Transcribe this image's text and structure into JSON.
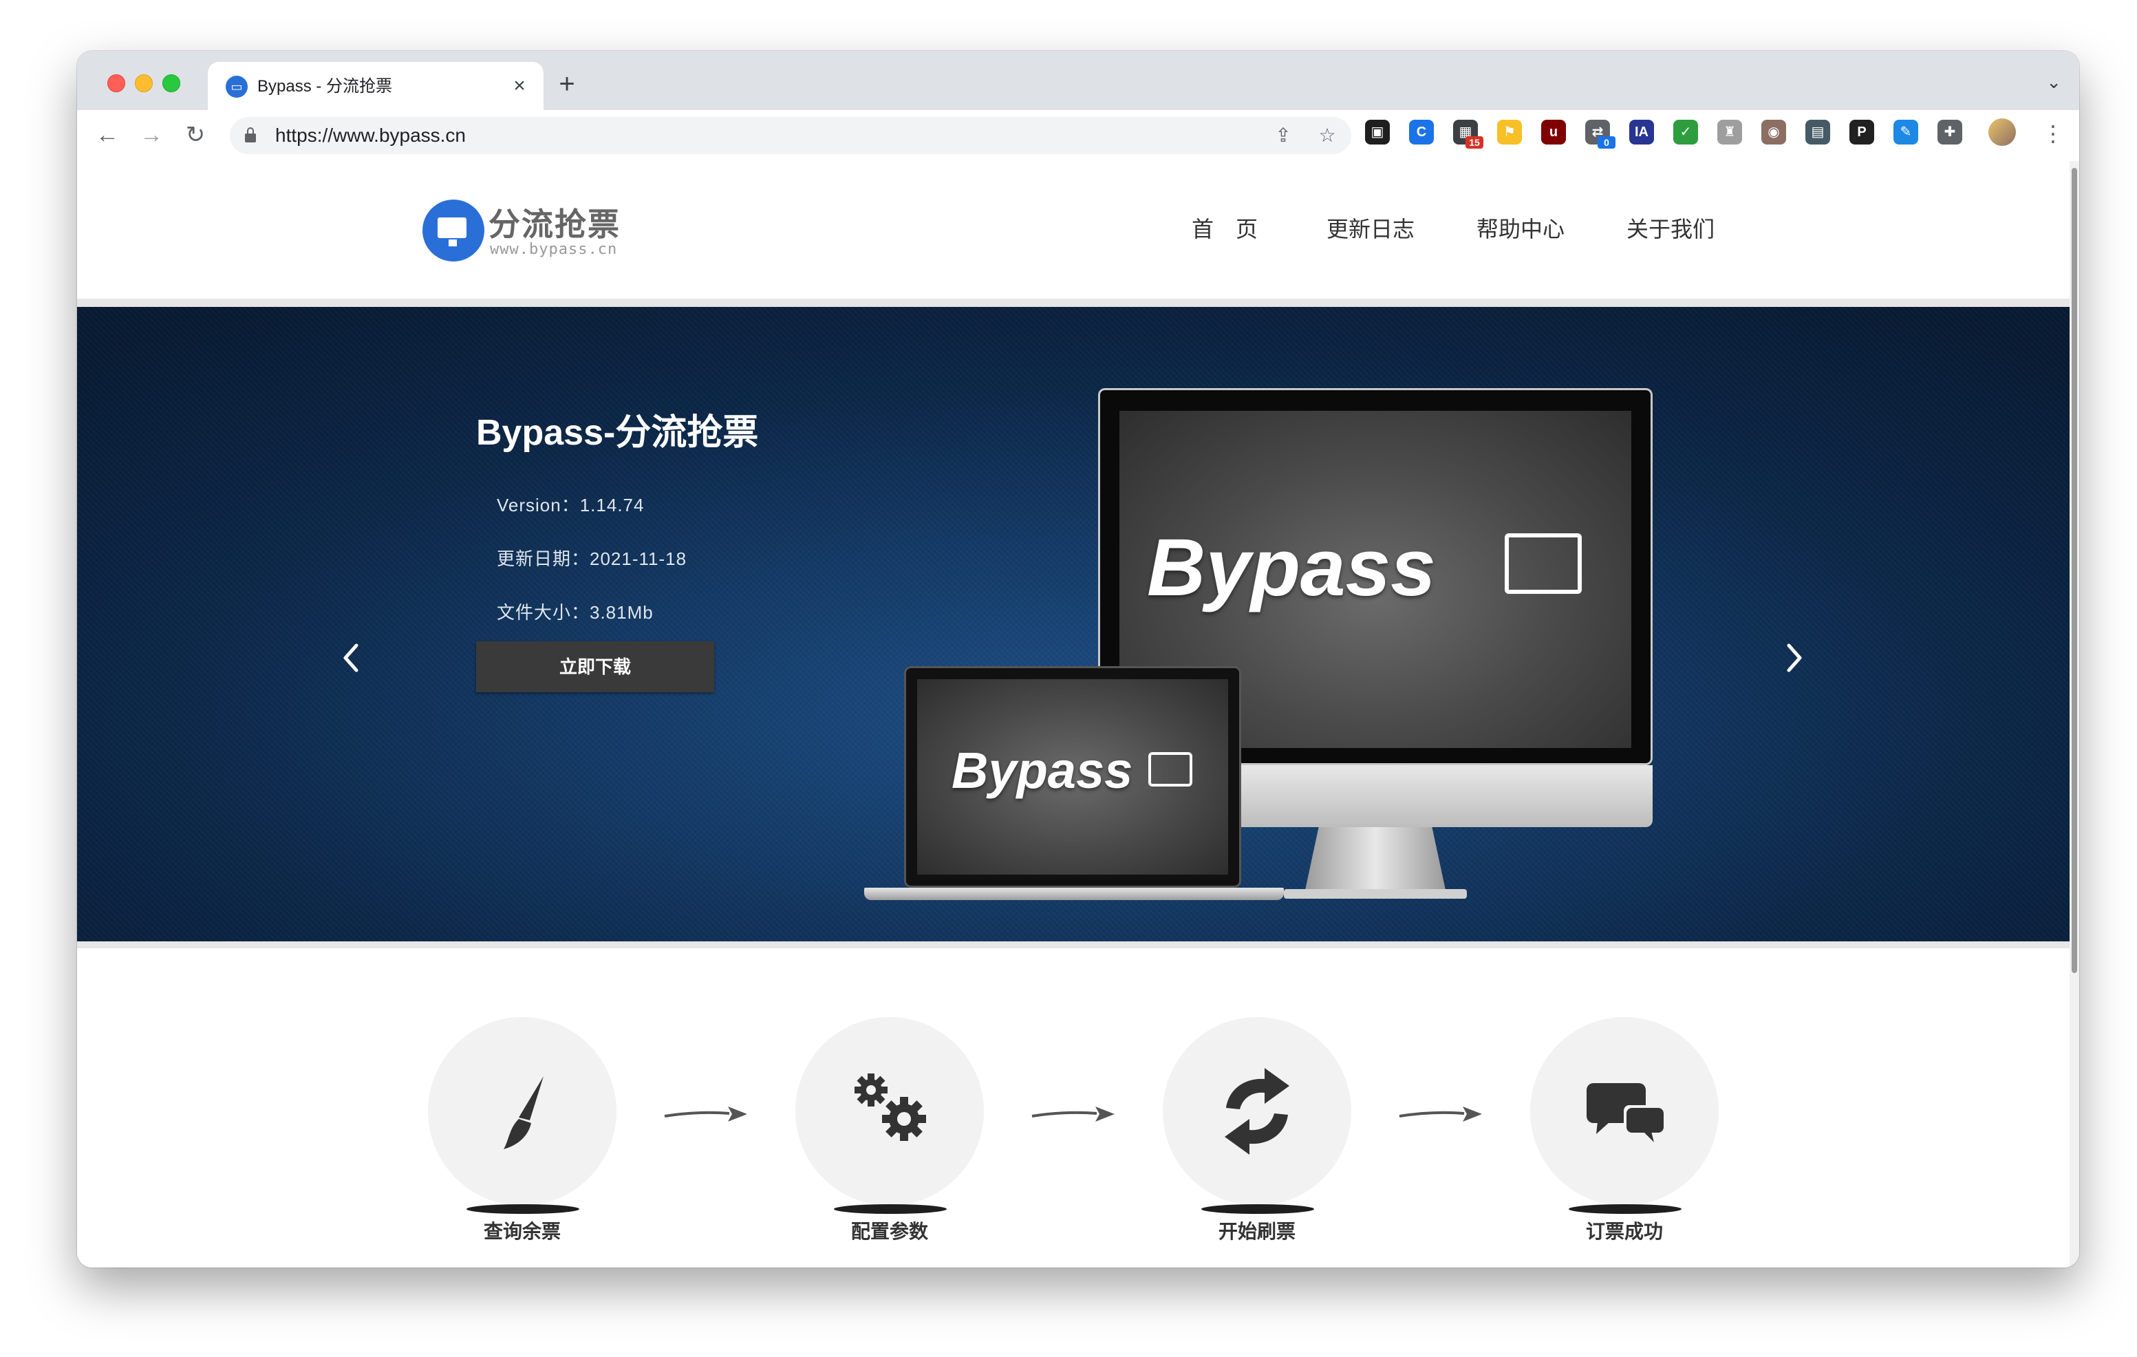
{
  "browser": {
    "tab_title": "Bypass - 分流抢票",
    "url": "https://www.bypass.cn",
    "extensions": [
      {
        "name": "tab-manager-extension",
        "color": "#1f1f1f",
        "glyph": "▣",
        "badge": ""
      },
      {
        "name": "chrome-extension-c",
        "color": "#1a73e8",
        "glyph": "C",
        "badge": ""
      },
      {
        "name": "grid-extension",
        "color": "#3c4043",
        "glyph": "▦",
        "badge": "15",
        "badge_color": "#d93025"
      },
      {
        "name": "bookmark-extension",
        "color": "#f6c026",
        "glyph": "⚑",
        "badge": ""
      },
      {
        "name": "ublock-extension",
        "color": "#800000",
        "glyph": "u",
        "badge": ""
      },
      {
        "name": "translate-extension",
        "color": "#5f6368",
        "glyph": "⇄",
        "badge": "0",
        "badge_color": "#1a73e8"
      },
      {
        "name": "ia-extension",
        "color": "#283593",
        "glyph": "IA",
        "badge": ""
      },
      {
        "name": "green-check-extension",
        "color": "#2e9d3e",
        "glyph": "✓",
        "badge": ""
      },
      {
        "name": "shield-extension",
        "color": "#9e9e9e",
        "glyph": "♜",
        "badge": ""
      },
      {
        "name": "owl-extension",
        "color": "#8d6e63",
        "glyph": "◉",
        "badge": ""
      },
      {
        "name": "window-extension",
        "color": "#455a64",
        "glyph": "▤",
        "badge": ""
      },
      {
        "name": "p-extension",
        "color": "#212121",
        "glyph": "P",
        "badge": ""
      },
      {
        "name": "doc-extension",
        "color": "#1e88e5",
        "glyph": "✎",
        "badge": ""
      },
      {
        "name": "puzzle-icon",
        "color": "#5f6368",
        "glyph": "✚",
        "badge": ""
      }
    ]
  },
  "site": {
    "logo_text": "分流抢票",
    "logo_sub": "www.bypass.cn",
    "nav": [
      "首　页",
      "更新日志",
      "帮助中心",
      "关于我们"
    ]
  },
  "banner": {
    "title": "Bypass-分流抢票",
    "version": "Version：1.14.74",
    "update_date": "更新日期：2021-11-18",
    "file_size": "文件大小：3.81Mb",
    "download_label": "立即下载",
    "brand_text": "Bypass"
  },
  "steps": [
    {
      "label": "查询余票",
      "icon": "brush-icon"
    },
    {
      "label": "配置参数",
      "icon": "gears-icon"
    },
    {
      "label": "开始刷票",
      "icon": "refresh-icon"
    },
    {
      "label": "订票成功",
      "icon": "chat-icon"
    }
  ]
}
